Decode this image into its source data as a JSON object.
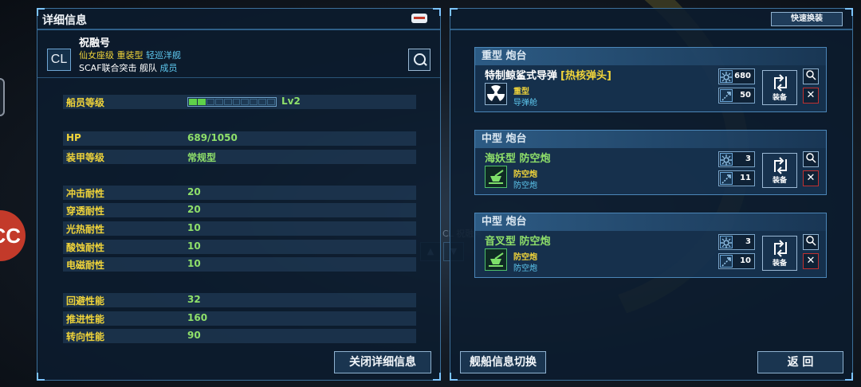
{
  "left_panel": {
    "title": "详细信息",
    "ship": {
      "class_abbr": "CL",
      "name": "祝融号",
      "line2_prefix": "仙女座级",
      "line2_type": "重装型",
      "line2_class": "轻巡洋舰",
      "line3_fleet": "SCAF联合突击 舰队",
      "line3_role": "成员"
    },
    "stats": [
      {
        "label": "船员等级",
        "kind": "level",
        "level_text": "Lv2",
        "level_filled": 2,
        "level_total": 10
      },
      {
        "label": "HP",
        "kind": "hp",
        "value": "689",
        "max": "/1050"
      },
      {
        "label": "装甲等级",
        "value": "常规型"
      },
      {
        "label": "冲击耐性",
        "value": "20"
      },
      {
        "label": "穿透耐性",
        "value": "20"
      },
      {
        "label": "光热耐性",
        "value": "10"
      },
      {
        "label": "酸蚀耐性",
        "value": "10"
      },
      {
        "label": "电磁耐性",
        "value": "10"
      },
      {
        "label": "回避性能",
        "value": "32"
      },
      {
        "label": "推进性能",
        "value": "160"
      },
      {
        "label": "转向性能",
        "value": "90"
      }
    ],
    "close_button": "关闭详细信息"
  },
  "right_panel": {
    "quick_swap": "快速换装",
    "turrets": [
      {
        "title": "重型 炮台",
        "weapon_name": "特制鲸鲨式导弹",
        "weapon_tag": "[热核弹头]",
        "weapon_type": "重型",
        "weapon_sub": "导弹舱",
        "stat1": "680",
        "stat2": "50",
        "icon": "radiation-icon"
      },
      {
        "title": "中型 炮台",
        "weapon_name": "海妖型 防空炮",
        "weapon_tag": "",
        "weapon_type": "防空炮",
        "weapon_sub": "防空炮",
        "stat1": "3",
        "stat2": "11",
        "icon": "aa-gun-icon"
      },
      {
        "title": "中型 炮台",
        "weapon_name": "音叉型 防空炮",
        "weapon_tag": "",
        "weapon_type": "防空炮",
        "weapon_sub": "防空炮",
        "stat1": "3",
        "stat2": "10",
        "icon": "aa-gun-icon"
      }
    ],
    "equip_label": "装备",
    "switch_button": "舰船信息切换",
    "back_button": "返 回"
  },
  "background": {
    "ship_label": "CL 祝融号"
  },
  "colors": {
    "label_yellow": "#f0d43a",
    "value_green": "#8fe06a",
    "accent_cyan": "#5ec8ef",
    "panel_border": "#3c6f99"
  }
}
